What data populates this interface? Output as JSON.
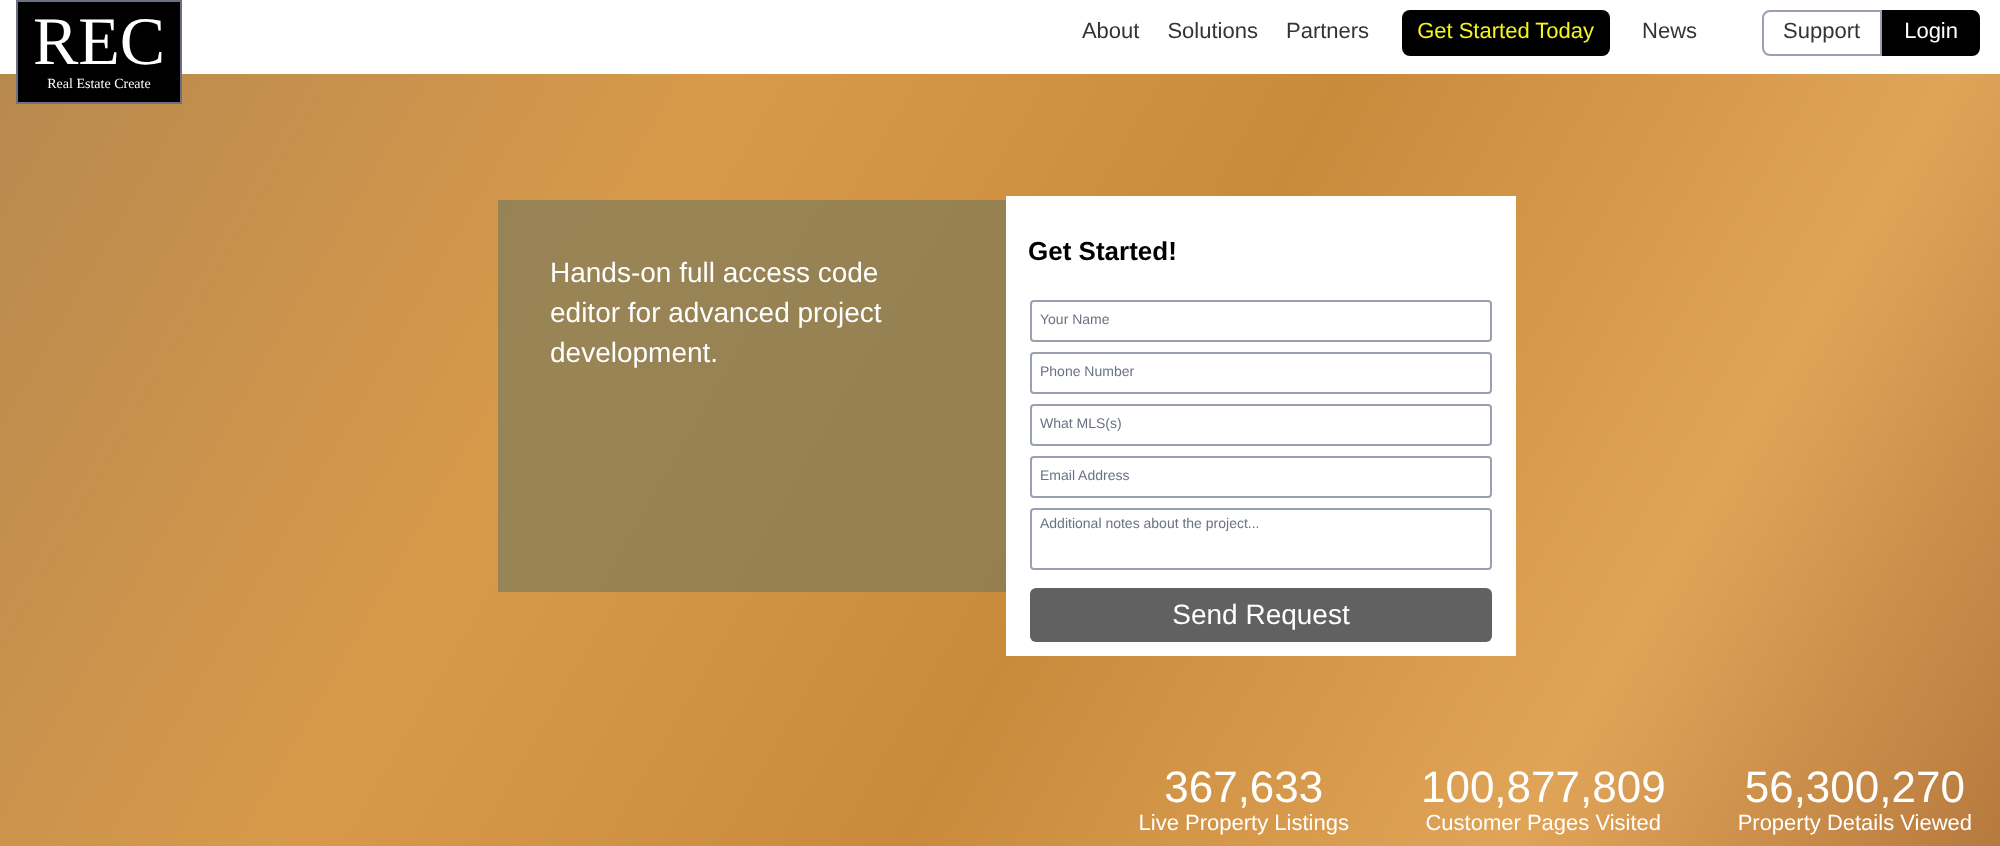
{
  "logo": {
    "title": "REC",
    "subtitle": "Real Estate Create"
  },
  "nav": [
    {
      "label": "About",
      "kind": "link"
    },
    {
      "label": "Solutions",
      "kind": "link"
    },
    {
      "label": "Partners",
      "kind": "link"
    },
    {
      "label": "Get Started Today",
      "kind": "cta"
    },
    {
      "label": "News",
      "kind": "link"
    }
  ],
  "account": [
    {
      "label": "Support",
      "selected": false
    },
    {
      "label": "Login",
      "selected": true
    }
  ],
  "tagline": "Hands-on full access code editor for advanced project development.",
  "form": {
    "title": "Get Started!",
    "fields": [
      {
        "placeholder": "Your Name",
        "kind": "input"
      },
      {
        "placeholder": "Phone Number",
        "kind": "input"
      },
      {
        "placeholder": "What MLS(s)",
        "kind": "input"
      },
      {
        "placeholder": "Email Address",
        "kind": "input"
      },
      {
        "placeholder": "Additional notes about the project...",
        "kind": "textarea"
      }
    ],
    "submit": "Send Request"
  },
  "stats": [
    {
      "value": "367,633",
      "label": "Live Property Listings"
    },
    {
      "value": "100,877,809",
      "label": "Customer Pages Visited"
    },
    {
      "value": "56,300,270",
      "label": "Property Details Viewed"
    }
  ]
}
